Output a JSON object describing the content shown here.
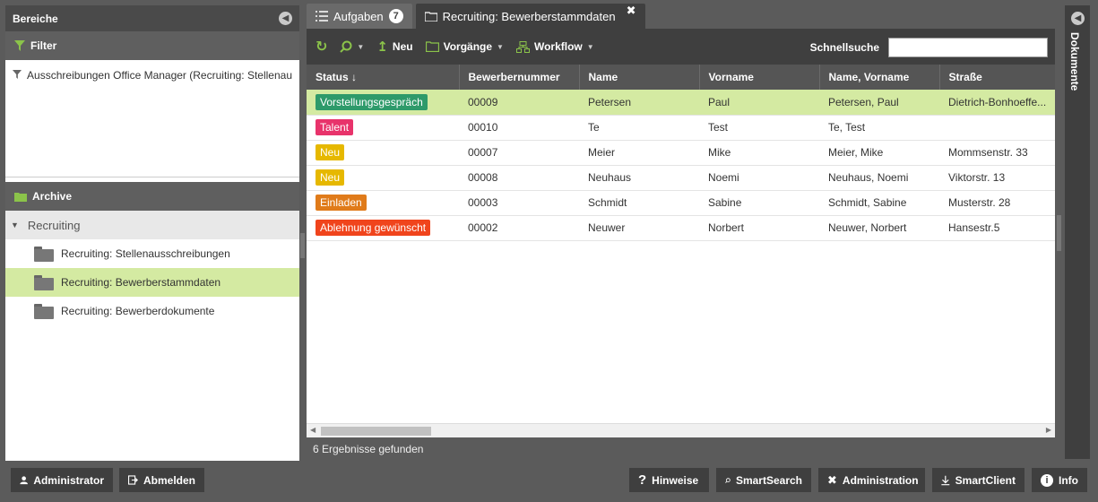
{
  "left": {
    "title": "Bereiche",
    "filter": {
      "title": "Filter",
      "item": "Ausschreibungen Office Manager (Recruiting: Stellenau"
    },
    "archive": {
      "title": "Archive",
      "group": "Recruiting",
      "items": [
        {
          "label": "Recruiting: Stellenausschreibungen"
        },
        {
          "label": "Recruiting: Bewerberstammdaten"
        },
        {
          "label": "Recruiting: Bewerberdokumente"
        }
      ]
    }
  },
  "tabs": [
    {
      "label": "Aufgaben",
      "badge": "7"
    },
    {
      "label": "Recruiting: Bewerberstammdaten"
    }
  ],
  "toolbar": {
    "neu": "Neu",
    "vorgaenge": "Vorgänge",
    "workflow": "Workflow",
    "schnellsuche": "Schnellsuche"
  },
  "grid": {
    "headers": [
      "Status ↓",
      "Bewerbernummer",
      "Name",
      "Vorname",
      "Name, Vorname",
      "Straße"
    ],
    "rows": [
      {
        "status": "Vorstellungsgespräch",
        "color": "#2e9a6a",
        "nr": "00009",
        "name": "Petersen",
        "vorname": "Paul",
        "nv": "Petersen, Paul",
        "strasse": "Dietrich-Bonhoeffe..."
      },
      {
        "status": "Talent",
        "color": "#e8336b",
        "nr": "00010",
        "name": "Te",
        "vorname": "Test",
        "nv": "Te, Test",
        "strasse": ""
      },
      {
        "status": "Neu",
        "color": "#e6b800",
        "nr": "00007",
        "name": "Meier",
        "vorname": "Mike",
        "nv": "Meier, Mike",
        "strasse": "Mommsenstr. 33"
      },
      {
        "status": "Neu",
        "color": "#e6b800",
        "nr": "00008",
        "name": "Neuhaus",
        "vorname": "Noemi",
        "nv": "Neuhaus, Noemi",
        "strasse": "Viktorstr. 13"
      },
      {
        "status": "Einladen",
        "color": "#e07b1a",
        "nr": "00003",
        "name": "Schmidt",
        "vorname": "Sabine",
        "nv": "Schmidt, Sabine",
        "strasse": "Musterstr. 28"
      },
      {
        "status": "Ablehnung gewünscht",
        "color": "#f0441c",
        "nr": "00002",
        "name": "Neuwer",
        "vorname": "Norbert",
        "nv": "Neuwer, Norbert",
        "strasse": "Hansestr.5"
      }
    ]
  },
  "status_line": "6 Ergebnisse gefunden",
  "docs": {
    "label": "Dokumente"
  },
  "bottom": {
    "administrator": "Administrator",
    "abmelden": "Abmelden",
    "hinweise": "Hinweise",
    "smartsearch": "SmartSearch",
    "administration": "Administration",
    "smartclient": "SmartClient",
    "info": "Info"
  }
}
